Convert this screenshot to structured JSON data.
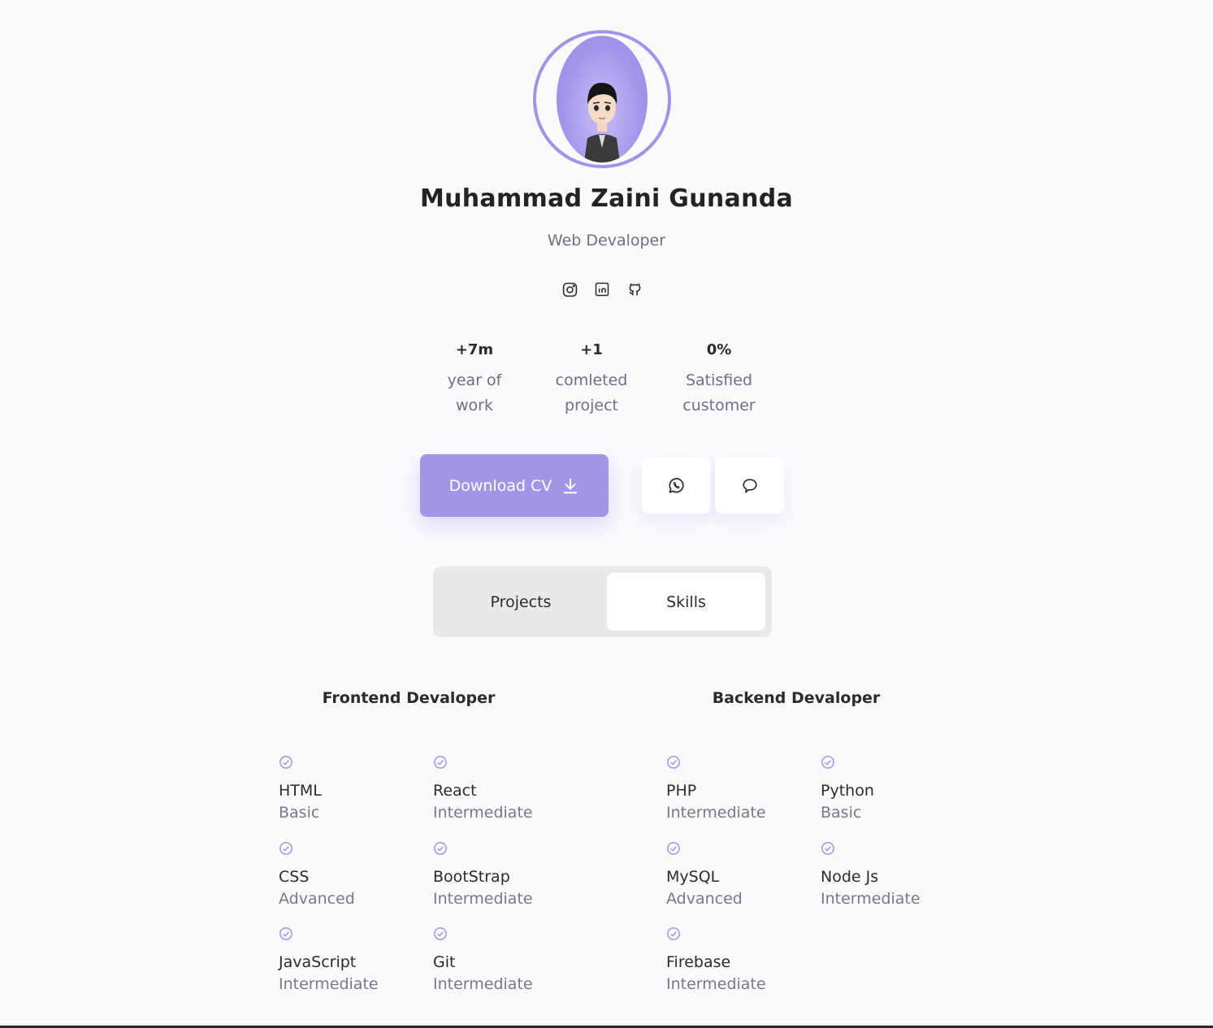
{
  "profile": {
    "name": "Muhammad Zaini Gunanda",
    "role": "Web Devaloper"
  },
  "socials": [
    {
      "icon": "instagram-icon"
    },
    {
      "icon": "linkedin-icon"
    },
    {
      "icon": "github-icon"
    }
  ],
  "stats": [
    {
      "value": "+7m",
      "label_line1": "year of",
      "label_line2": "work"
    },
    {
      "value": "+1",
      "label_line1": "comleted",
      "label_line2": "project"
    },
    {
      "value": "0%",
      "label_line1": "Satisfied",
      "label_line2": "customer"
    }
  ],
  "actions": {
    "download_label": "Download CV",
    "whatsapp_icon": "whatsapp-icon",
    "message_icon": "message-icon"
  },
  "tabs": {
    "projects": "Projects",
    "skills": "Skills",
    "active": "Skills"
  },
  "skills": {
    "frontend": {
      "title": "Frontend Devaloper",
      "items": [
        {
          "name": "HTML",
          "level": "Basic"
        },
        {
          "name": "React",
          "level": "Intermediate"
        },
        {
          "name": "CSS",
          "level": "Advanced"
        },
        {
          "name": "BootStrap",
          "level": "Intermediate"
        },
        {
          "name": "JavaScript",
          "level": "Intermediate"
        },
        {
          "name": "Git",
          "level": "Intermediate"
        }
      ]
    },
    "backend": {
      "title": "Backend Devaloper",
      "items": [
        {
          "name": "PHP",
          "level": "Intermediate"
        },
        {
          "name": "Python",
          "level": "Basic"
        },
        {
          "name": "MySQL",
          "level": "Advanced"
        },
        {
          "name": "Node Js",
          "level": "Intermediate"
        },
        {
          "name": "Firebase",
          "level": "Intermediate"
        }
      ]
    }
  },
  "colors": {
    "accent": "#a195e8",
    "background": "#fafafd",
    "muted_text": "#6e6e86"
  }
}
